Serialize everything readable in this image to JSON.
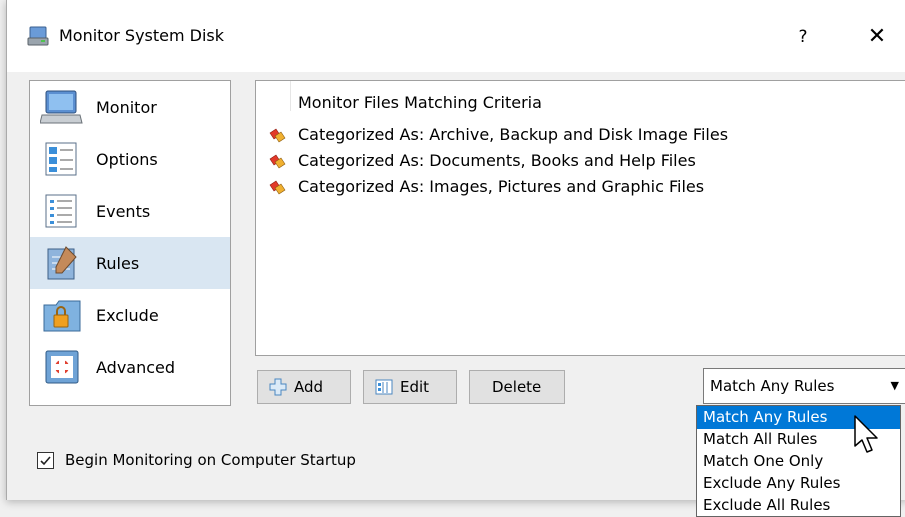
{
  "window": {
    "title": "Monitor System Disk",
    "help_glyph": "?",
    "close_glyph": "✕"
  },
  "nav": {
    "items": [
      {
        "label": "Monitor",
        "icon": "monitor-icon"
      },
      {
        "label": "Options",
        "icon": "options-icon"
      },
      {
        "label": "Events",
        "icon": "events-icon"
      },
      {
        "label": "Rules",
        "icon": "rules-icon",
        "selected": true
      },
      {
        "label": "Exclude",
        "icon": "exclude-folder-icon"
      },
      {
        "label": "Advanced",
        "icon": "advanced-icon"
      }
    ]
  },
  "rules_list": {
    "header": "Monitor Files Matching Criteria",
    "items": [
      {
        "text": "Categorized As: Archive, Backup and Disk Image Files",
        "icon": "rule-bullet-icon"
      },
      {
        "text": "Categorized As: Documents, Books and Help Files",
        "icon": "rule-bullet-icon"
      },
      {
        "text": "Categorized As: Images, Pictures and Graphic Files",
        "icon": "rule-bullet-icon"
      }
    ]
  },
  "buttons": {
    "add": "Add",
    "edit": "Edit",
    "delete": "Delete"
  },
  "match_mode": {
    "selected": "Match Any Rules",
    "options": [
      "Match Any Rules",
      "Match All Rules",
      "Match One Only",
      "Exclude Any Rules",
      "Exclude All Rules"
    ]
  },
  "startup": {
    "label": "Begin Monitoring on Computer Startup",
    "checked": true
  },
  "colors": {
    "selection": "#0078d7",
    "nav_selected": "#d9e6f2"
  }
}
